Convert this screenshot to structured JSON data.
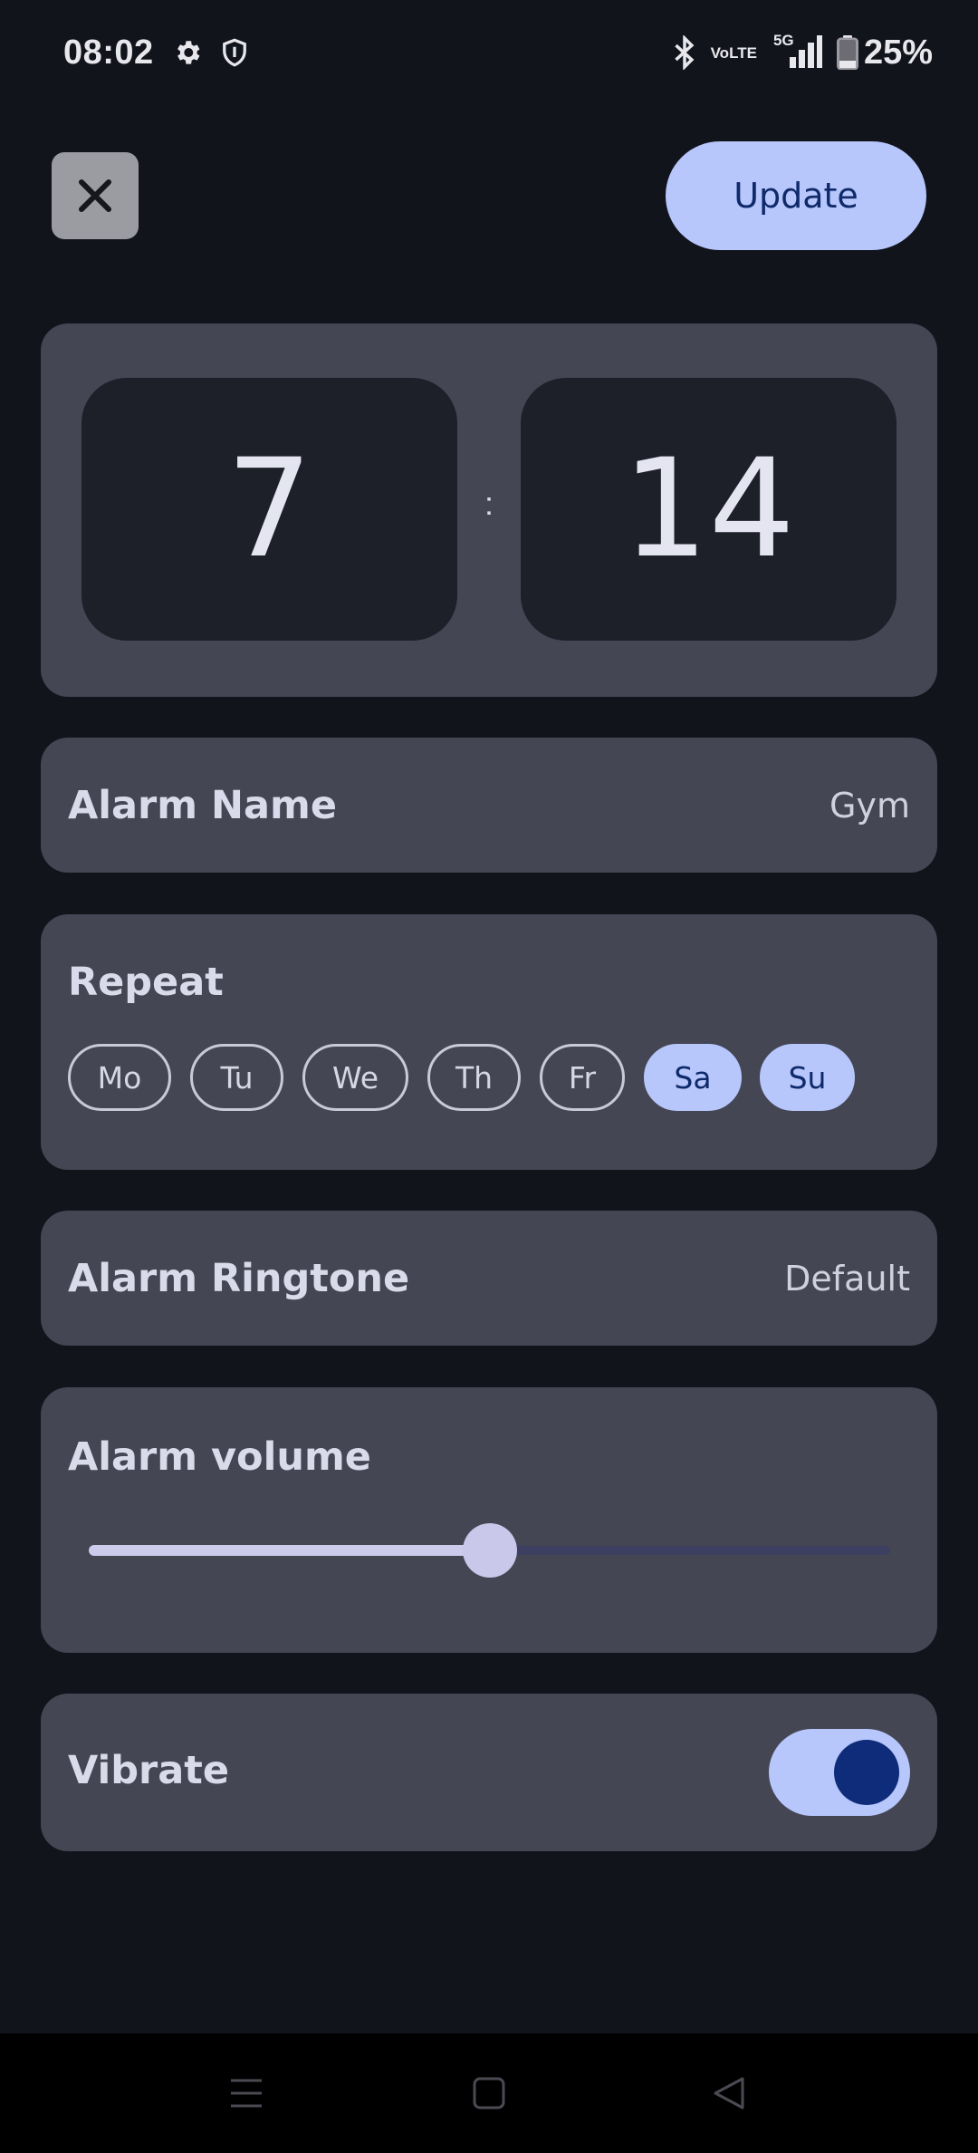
{
  "status_bar": {
    "time": "08:02",
    "battery": "25%",
    "icons": [
      "settings-icon",
      "shield-icon",
      "bluetooth-icon",
      "volte-icon",
      "5g-signal-icon",
      "battery-icon"
    ],
    "volte_top": "Vo",
    "volte_bottom": "LTE",
    "network": "5G"
  },
  "top_bar": {
    "close_icon": "close-icon",
    "update_label": "Update"
  },
  "time_picker": {
    "hour": "7",
    "separator": ":",
    "minute": "14"
  },
  "alarm_name": {
    "label": "Alarm Name",
    "value": "Gym"
  },
  "repeat": {
    "label": "Repeat",
    "days": [
      {
        "label": "Mo",
        "selected": false
      },
      {
        "label": "Tu",
        "selected": false
      },
      {
        "label": "We",
        "selected": false
      },
      {
        "label": "Th",
        "selected": false
      },
      {
        "label": "Fr",
        "selected": false
      },
      {
        "label": "Sa",
        "selected": true
      },
      {
        "label": "Su",
        "selected": true
      }
    ]
  },
  "ringtone": {
    "label": "Alarm Ringtone",
    "value": "Default"
  },
  "volume": {
    "label": "Alarm volume",
    "level": 0.5
  },
  "vibrate": {
    "label": "Vibrate",
    "enabled": true
  },
  "colors": {
    "background": "#12141c",
    "card": "#444654",
    "accent": "#b7c6fb",
    "accent_text": "#0f2a6a"
  },
  "nav_bar": {
    "icons": [
      "menu-icon",
      "home-icon",
      "back-icon"
    ]
  }
}
